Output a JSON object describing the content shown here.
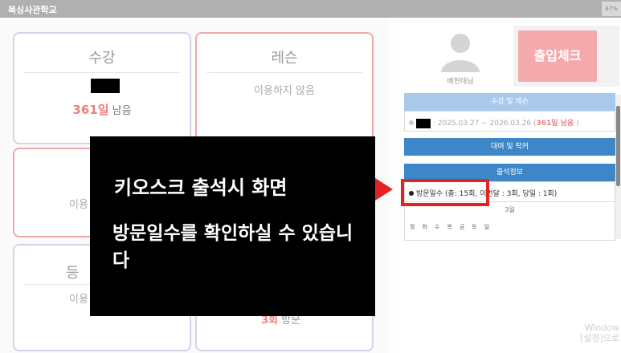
{
  "window": {
    "title": "복싱사관학교",
    "zoom": "67%"
  },
  "cards": {
    "course": {
      "title": "수강",
      "remaining_days": "361일",
      "remaining_suffix": " 남음"
    },
    "lesson": {
      "title": "레슨",
      "note": "이용하지 않음"
    },
    "card3": {
      "note": "이용"
    },
    "card4": {
      "title": "등",
      "note": "이용"
    },
    "card5": {
      "count": "3회",
      "suffix": " 방문"
    }
  },
  "profile": {
    "name": "배현태님"
  },
  "checkin_label": "출입체크",
  "panels": {
    "course_lesson": {
      "title": "수강 및 레슨",
      "period_prefix": " : 2025.03.27 ~ 2026.03.26 (",
      "period_days": "361일 남음",
      "period_suffix": " )"
    },
    "rental": {
      "title": "대여 및 락커"
    },
    "attendance": {
      "title": "출석정보",
      "visits": "방문일수 (총: 15회, 이번달 : 3회, 당일 : 1회)",
      "month": "3월",
      "weekdays": [
        "월",
        "화",
        "수",
        "목",
        "금",
        "토",
        "일"
      ]
    }
  },
  "overlay": {
    "line1": "키오스크 출석시 화면",
    "line2": "방문일수를 확인하실 수 있습니다"
  },
  "watermark": {
    "line1": "Window",
    "line2": "[설정]으로"
  },
  "colors": {
    "accent_red": "#e52222",
    "checkin_bg": "#f4aaaa",
    "panel_blue": "#3d86c8",
    "panel_light": "#a9c9ec"
  }
}
